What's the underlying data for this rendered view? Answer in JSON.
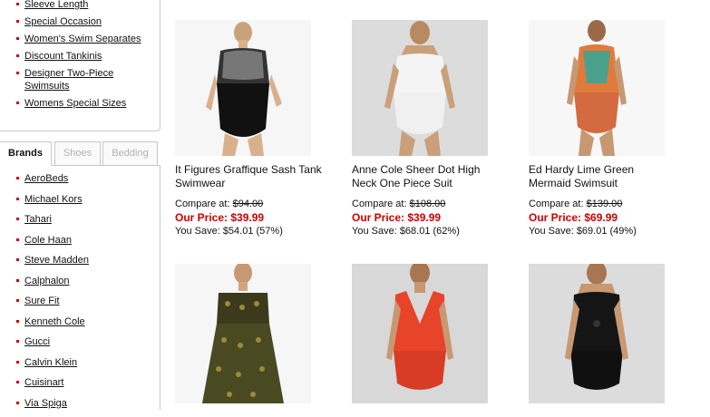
{
  "categories": [
    {
      "label": "Sleeve Length"
    },
    {
      "label": "Special Occasion"
    },
    {
      "label": "Women's Swim Separates"
    },
    {
      "label": "Discount Tankinis"
    },
    {
      "label": "Designer Two-Piece Swimsuits"
    },
    {
      "label": "Womens Special Sizes"
    }
  ],
  "tabs": [
    {
      "label": "Brands"
    },
    {
      "label": "Shoes"
    },
    {
      "label": "Bedding"
    }
  ],
  "brands": [
    {
      "label": "AeroBeds"
    },
    {
      "label": "Michael Kors"
    },
    {
      "label": "Tahari"
    },
    {
      "label": "Cole Haan"
    },
    {
      "label": "Steve Madden"
    },
    {
      "label": "Calphalon"
    },
    {
      "label": "Sure Fit"
    },
    {
      "label": "Kenneth Cole"
    },
    {
      "label": "Gucci"
    },
    {
      "label": "Calvin Klein"
    },
    {
      "label": "Cuisinart"
    },
    {
      "label": "Via Spiga"
    }
  ],
  "products": [
    {
      "name": "It Figures Graffique Sash Tank Swimwear",
      "compare_label": "Compare at:",
      "compare_price": "$94.00",
      "price_label": "Our Price:",
      "price": "$39.99",
      "save_label": "You Save:",
      "save": "$54.01 (57%)"
    },
    {
      "name": "Anne Cole Sheer Dot High Neck One Piece Suit",
      "compare_label": "Compare at:",
      "compare_price": "$108.00",
      "price_label": "Our Price:",
      "price": "$39.99",
      "save_label": "You Save:",
      "save": "$68.01 (62%)"
    },
    {
      "name": "Ed Hardy Lime Green Mermaid Swimsuit",
      "compare_label": "Compare at:",
      "compare_price": "$139.00",
      "price_label": "Our Price:",
      "price": "$69.99",
      "save_label": "You Save:",
      "save": "$69.01 (49%)"
    },
    {
      "name": "",
      "compare_label": "",
      "compare_price": "",
      "price_label": "",
      "price": "",
      "save_label": "",
      "save": ""
    },
    {
      "name": "",
      "compare_label": "",
      "compare_price": "",
      "price_label": "",
      "price": "",
      "save_label": "",
      "save": ""
    },
    {
      "name": "",
      "compare_label": "",
      "compare_price": "",
      "price_label": "",
      "price": "",
      "save_label": "",
      "save": ""
    }
  ],
  "colors": {
    "accent_red": "#cc0000",
    "border": "#c8c8c8",
    "tab_inactive_text": "#b0b0b0"
  }
}
